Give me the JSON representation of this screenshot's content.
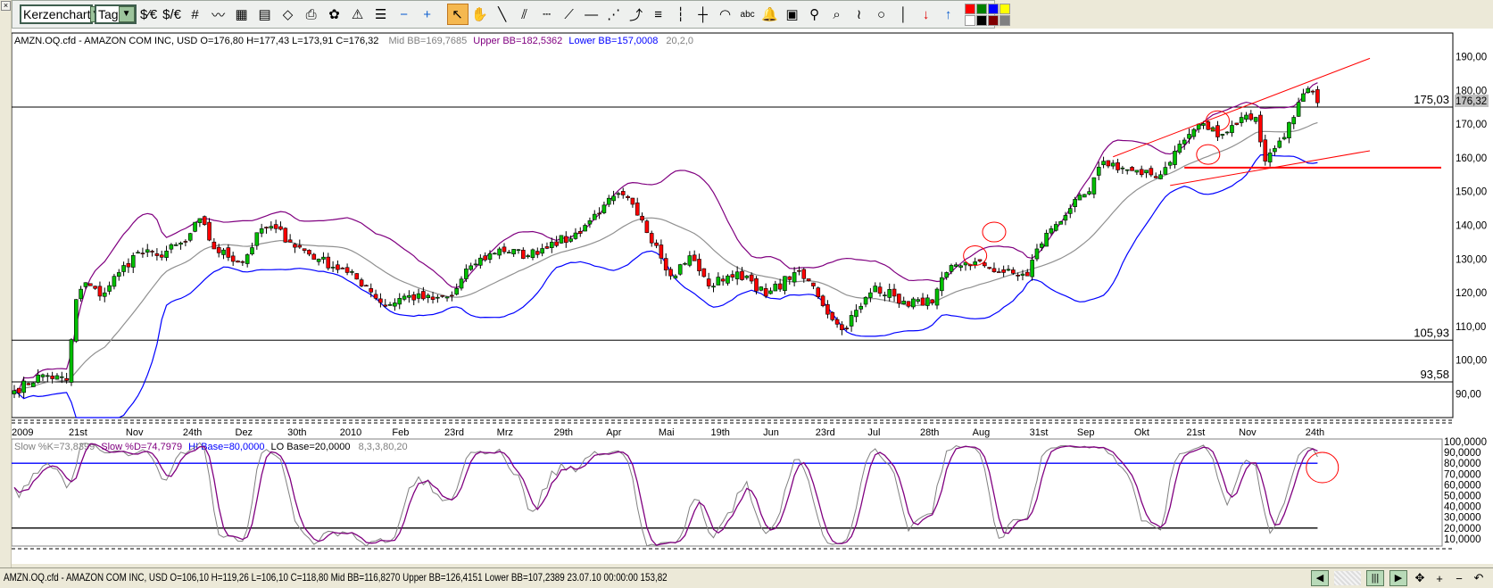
{
  "toolbar": {
    "chart_type": "Kerzenchart",
    "period": "Tag",
    "icons_group1": [
      "currency-dollar-euro-icon",
      "currency-convert-icon",
      "grid-icon",
      "indicator-icon",
      "template-icon",
      "chart-data-icon",
      "open-icon",
      "print-icon",
      "color-icon",
      "alarm-indicator-icon",
      "list-indicator-icon",
      "zoom-out-icon",
      "zoom-in-icon"
    ],
    "icons_group2": [
      "cursor-icon",
      "hand-icon",
      "line-icon",
      "parallel-lines-icon",
      "horizontal-grid-icon",
      "fan-icon",
      "horizontal-line-icon",
      "gann-fan-icon",
      "regression-icon",
      "fibonacci-icon",
      "vertical-grid-icon",
      "crosshair-icon",
      "arc-icon",
      "text-icon",
      "bell-icon",
      "calculator-icon",
      "magnifier-icon",
      "zoom-box-icon",
      "freehand-icon",
      "circle-icon",
      "vertical-line-icon",
      "sell-arrow-icon",
      "buy-arrow-icon"
    ],
    "swatches": [
      "#ff0000",
      "#008000",
      "#0000ff",
      "#ffff00",
      "#ffffff",
      "#000000",
      "#800000",
      "#808080"
    ]
  },
  "main_panel": {
    "symbol_info": "AMZN.OQ.cfd - AMAZON COM INC, USD O=176,80 H=177,43 L=173,91 C=176,32",
    "mid_bb": "Mid BB=169,7685",
    "upper_bb": "Upper BB=182,5362",
    "lower_bb": "Lower BB=157,0008",
    "bb_params": "20,2,0",
    "last_price": "176,32",
    "hlines": [
      {
        "value": 175.03,
        "label": "175,03"
      },
      {
        "value": 105.93,
        "label": "105,93"
      },
      {
        "value": 93.58,
        "label": "93,58"
      }
    ],
    "colors": {
      "up": "#00c000",
      "down": "#ff0000",
      "mid": "#909090",
      "upper": "#800080",
      "lower": "#0000ff",
      "drawing": "#ff0000"
    }
  },
  "stoch_panel": {
    "k_label": "Slow %K=73,8399",
    "d_label": "Slow %D=74,7979",
    "hi_label": "HI Base=80,0000",
    "lo_label": "LO Base=20,0000",
    "params": "8,3,3,80,20"
  },
  "status_bar": {
    "text": "AMZN.OQ.cfd - AMAZON COM INC, USD O=106,10 H=119,26 L=106,10 C=118,80  Mid BB=116,8270 Upper BB=126,4151 Lower BB=107,2389  23.07.10 00:00:00 153,82",
    "nav": [
      "scroll-left",
      "scroll-thumb",
      "scroll-right",
      "move",
      "zoom-in",
      "zoom-out",
      "reset"
    ]
  },
  "chart_data": {
    "type": "candlestick",
    "bars": 275,
    "price_axis": {
      "min": 83,
      "max": 197,
      "ticks": [
        190,
        180,
        170,
        160,
        150,
        140,
        130,
        120,
        110,
        100,
        90
      ],
      "tick_labels": [
        "190,00",
        "180,00",
        "170,00",
        "160,00",
        "150,00",
        "140,00",
        "130,00",
        "120,00",
        "110,00",
        "100,00",
        "90,00"
      ]
    },
    "date_labels": [
      {
        "bar": 0,
        "label": "2009"
      },
      {
        "bar": 12,
        "label": "21st"
      },
      {
        "bar": 24,
        "label": "Nov"
      },
      {
        "bar": 36,
        "label": "24th"
      },
      {
        "bar": 47,
        "label": "Dez"
      },
      {
        "bar": 58,
        "label": "30th"
      },
      {
        "bar": 69,
        "label": "2010"
      },
      {
        "bar": 80,
        "label": "Feb"
      },
      {
        "bar": 91,
        "label": "23rd"
      },
      {
        "bar": 102,
        "label": "Mrz"
      },
      {
        "bar": 114,
        "label": "29th"
      },
      {
        "bar": 125,
        "label": "Apr"
      },
      {
        "bar": 136,
        "label": "Mai"
      },
      {
        "bar": 147,
        "label": "19th"
      },
      {
        "bar": 158,
        "label": "Jun"
      },
      {
        "bar": 169,
        "label": "23rd"
      },
      {
        "bar": 180,
        "label": "Jul"
      },
      {
        "bar": 191,
        "label": "28th"
      },
      {
        "bar": 202,
        "label": "Aug"
      },
      {
        "bar": 214,
        "label": "31st"
      },
      {
        "bar": 224,
        "label": "Sep"
      },
      {
        "bar": 236,
        "label": "Okt"
      },
      {
        "bar": 247,
        "label": "21st"
      },
      {
        "bar": 258,
        "label": "Nov"
      },
      {
        "bar": 272,
        "label": "24th"
      }
    ],
    "close_anchors": [
      [
        0,
        91
      ],
      [
        6,
        95.7
      ],
      [
        11,
        94
      ],
      [
        13,
        118
      ],
      [
        15,
        123
      ],
      [
        18,
        119
      ],
      [
        22,
        126
      ],
      [
        26,
        132
      ],
      [
        30,
        131
      ],
      [
        36,
        135
      ],
      [
        39,
        142
      ],
      [
        42,
        133
      ],
      [
        48,
        129
      ],
      [
        52,
        139
      ],
      [
        55,
        139
      ],
      [
        58,
        135
      ],
      [
        64,
        130
      ],
      [
        70,
        126
      ],
      [
        74,
        122
      ],
      [
        78,
        116
      ],
      [
        82,
        119
      ],
      [
        88,
        118
      ],
      [
        92,
        119
      ],
      [
        96,
        128
      ],
      [
        102,
        133
      ],
      [
        108,
        131
      ],
      [
        113,
        135
      ],
      [
        117,
        136
      ],
      [
        120,
        140
      ],
      [
        124,
        146
      ],
      [
        128,
        149
      ],
      [
        131,
        143
      ],
      [
        135,
        134
      ],
      [
        138,
        125
      ],
      [
        142,
        131
      ],
      [
        146,
        122
      ],
      [
        150,
        125
      ],
      [
        154,
        125
      ],
      [
        158,
        119
      ],
      [
        164,
        126
      ],
      [
        168,
        122
      ],
      [
        172,
        112
      ],
      [
        174,
        109
      ],
      [
        178,
        116
      ],
      [
        181,
        122
      ],
      [
        185,
        119
      ],
      [
        188,
        116
      ],
      [
        190,
        118
      ],
      [
        193,
        117
      ],
      [
        196,
        126
      ],
      [
        200,
        129
      ],
      [
        204,
        128
      ],
      [
        208,
        126
      ],
      [
        213,
        125
      ],
      [
        215,
        133
      ],
      [
        218,
        139
      ],
      [
        222,
        145
      ],
      [
        226,
        150
      ],
      [
        229,
        159
      ],
      [
        233,
        157
      ],
      [
        237,
        155
      ],
      [
        241,
        155
      ],
      [
        244,
        162
      ],
      [
        249,
        170
      ],
      [
        254,
        167
      ],
      [
        258,
        172
      ],
      [
        261,
        172
      ],
      [
        263,
        159
      ],
      [
        266,
        165
      ],
      [
        269,
        172
      ],
      [
        271,
        179
      ],
      [
        273,
        179.5
      ],
      [
        274,
        176.32
      ]
    ],
    "bollinger": {
      "period": 20,
      "stddev": 2
    },
    "stochastic": {
      "k": 8,
      "slow": 3,
      "d": 3,
      "hi": 80,
      "lo": 20,
      "ticks": [
        100,
        90,
        80,
        70,
        60,
        50,
        40,
        30,
        20,
        10
      ],
      "tick_labels": [
        "100,0000",
        "90,0000",
        "80,0000",
        "70,0000",
        "60,0000",
        "50,0000",
        "40,0000",
        "30,0000",
        "20,0000",
        "10,0000"
      ]
    },
    "drawings": {
      "support_line": {
        "value": 157.1,
        "from_bar": 246,
        "to_bar": 300
      },
      "upper_trend": [
        [
          231,
          160.3
        ],
        [
          285,
          189.5
        ]
      ],
      "lower_trend": [
        [
          243,
          151.8
        ],
        [
          285,
          162.1
        ]
      ],
      "circles": [
        [
          202,
          131
        ],
        [
          206,
          138
        ],
        [
          253,
          171
        ],
        [
          251,
          161
        ]
      ],
      "stoch_circle": [
        [
          275,
          76
        ]
      ]
    }
  }
}
